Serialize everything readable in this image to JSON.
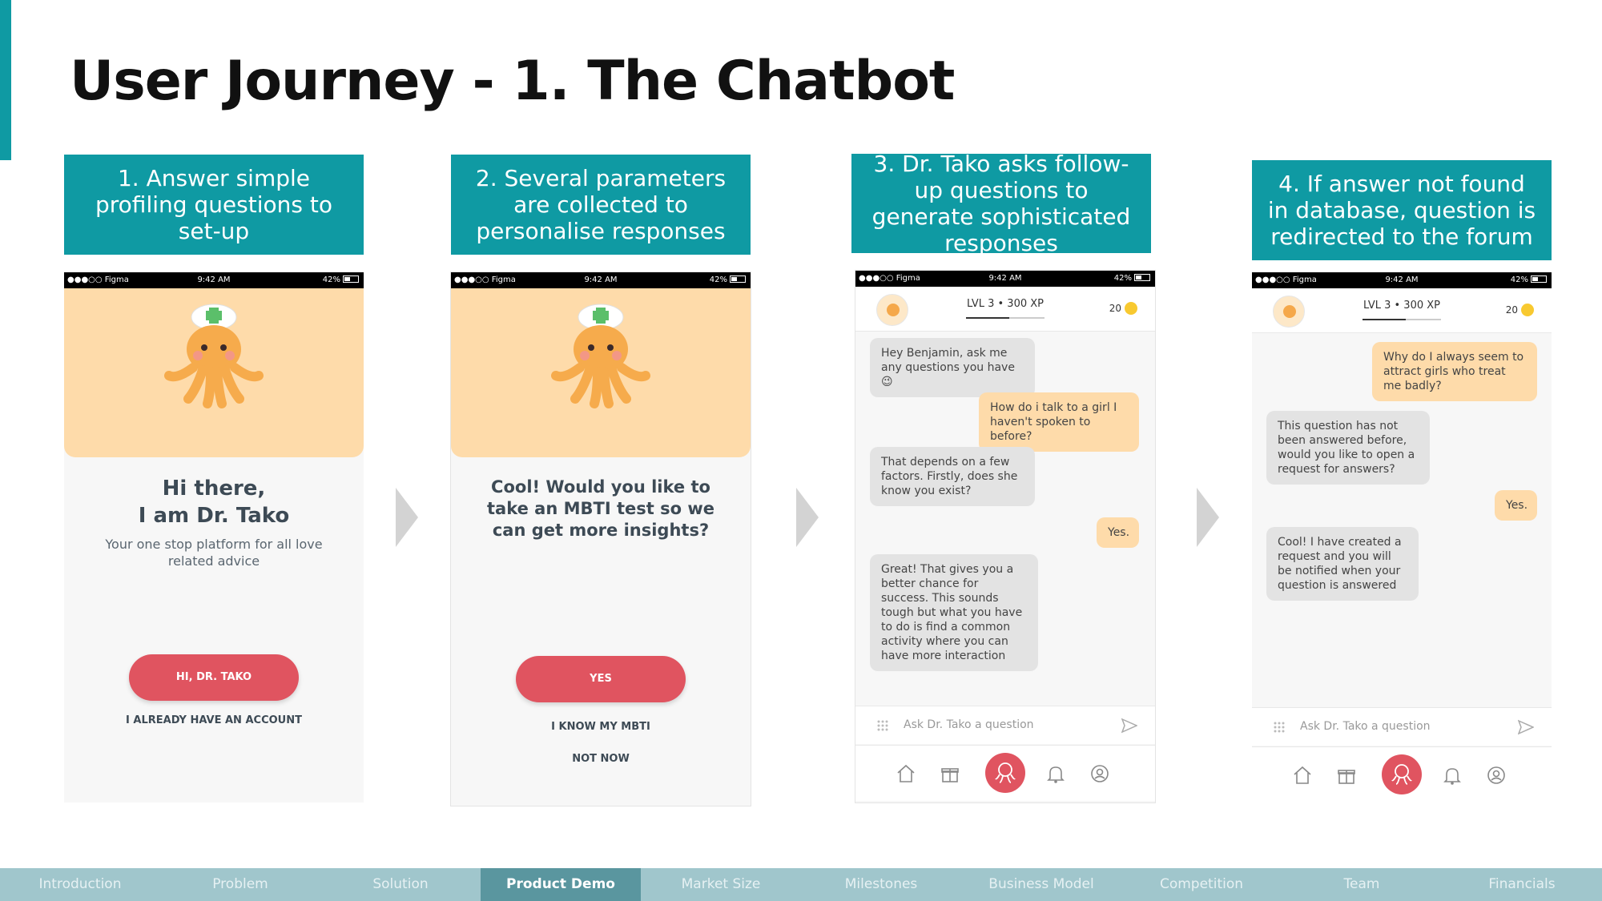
{
  "title": "User Journey - 1. The Chatbot",
  "steps": [
    {
      "header": "1. Answer simple profiling questions to set-up"
    },
    {
      "header": "2. Several parameters are collected to personalise responses"
    },
    {
      "header": "3. Dr. Tako asks follow-up questions to generate sophisticated responses"
    },
    {
      "header": "4. If answer not found in database, question is redirected to the forum"
    }
  ],
  "status_bar": {
    "carrier": "●●●○○ Figma",
    "time": "9:42 AM",
    "battery": "42%"
  },
  "screen1": {
    "title_line1": "Hi there,",
    "title_line2": "I am Dr. Tako",
    "subtitle": "Your one stop platform for all love related advice",
    "primary_button": "HI, DR. TAKO",
    "secondary_link": "I ALREADY HAVE AN ACCOUNT"
  },
  "screen2": {
    "question": "Cool! Would you like to take an MBTI test so we can get more insights?",
    "primary_button": "YES",
    "link1": "I KNOW MY MBTI",
    "link2": "NOT NOW"
  },
  "chat_header": {
    "level": "LVL 3",
    "xp": "• 300 XP",
    "xp_progress": 0.55,
    "coins": "20"
  },
  "screen3": {
    "messages": [
      {
        "from": "bot",
        "text": "Hey Benjamin, ask me any questions you have 😉"
      },
      {
        "from": "user",
        "text": "How do i talk to a girl I haven't spoken to before?"
      },
      {
        "from": "bot",
        "text": "That depends on a few factors. Firstly, does she know you exist?"
      },
      {
        "from": "user",
        "text": "Yes."
      },
      {
        "from": "bot",
        "text": "Great! That gives you a better chance for success. This sounds tough but what you have to do is find a common activity where you can have more interaction"
      }
    ]
  },
  "screen4": {
    "messages": [
      {
        "from": "user",
        "text": "Why do I always seem to attract girls who treat me badly?"
      },
      {
        "from": "bot",
        "text": "This question has not been answered before, would you like to open a request for answers?"
      },
      {
        "from": "user",
        "text": "Yes."
      },
      {
        "from": "bot",
        "text": "Cool! I have created a request and you will be notified when your question is answered"
      }
    ]
  },
  "chat_input": {
    "placeholder": "Ask Dr. Tako a question"
  },
  "colors": {
    "teal": "#0f9aa3",
    "peach": "#fedbaa",
    "coral": "#e05460",
    "nav": "#a0c6cc",
    "nav_active": "#5a969f"
  },
  "footer_nav": {
    "items": [
      "Introduction",
      "Problem",
      "Solution",
      "Product Demo",
      "Market Size",
      "Milestones",
      "Business Model",
      "Competition",
      "Team",
      "Financials"
    ],
    "active": "Product Demo"
  }
}
